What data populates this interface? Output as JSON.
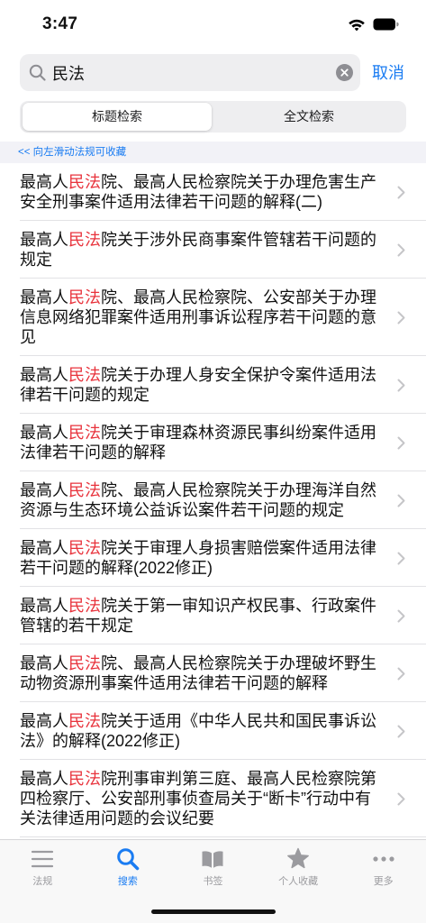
{
  "status_bar": {
    "time": "3:47",
    "wifi_icon": "wifi-icon",
    "battery_icon": "battery-icon"
  },
  "search": {
    "query": "民法",
    "search_icon": "search-icon",
    "clear_icon": "clear-icon",
    "cancel_label": "取消"
  },
  "segmented_control": {
    "options": [
      {
        "label": "标题检索",
        "selected": true
      },
      {
        "label": "全文检索",
        "selected": false
      }
    ]
  },
  "hint": {
    "text": "<< 向左滑动法规可收藏"
  },
  "results": [
    {
      "before": "最高人",
      "match": "民法",
      "after": "院、最高人民检察院关于办理危害生产安全刑事案件适用法律若干问题的解释(二)"
    },
    {
      "before": "最高人",
      "match": "民法",
      "after": "院关于涉外民商事案件管辖若干问题的规定"
    },
    {
      "before": "最高人",
      "match": "民法",
      "after": "院、最高人民检察院、公安部关于办理信息网络犯罪案件适用刑事诉讼程序若干问题的意见"
    },
    {
      "before": "最高人",
      "match": "民法",
      "after": "院关于办理人身安全保护令案件适用法律若干问题的规定"
    },
    {
      "before": "最高人",
      "match": "民法",
      "after": "院关于审理森林资源民事纠纷案件适用法律若干问题的解释"
    },
    {
      "before": "最高人",
      "match": "民法",
      "after": "院、最高人民检察院关于办理海洋自然资源与生态环境公益诉讼案件若干问题的规定"
    },
    {
      "before": "最高人",
      "match": "民法",
      "after": "院关于审理人身损害赔偿案件适用法律若干问题的解释(2022修正)"
    },
    {
      "before": "最高人",
      "match": "民法",
      "after": "院关于第一审知识产权民事、行政案件管辖的若干规定"
    },
    {
      "before": "最高人",
      "match": "民法",
      "after": "院、最高人民检察院关于办理破坏野生动物资源刑事案件适用法律若干问题的解释"
    },
    {
      "before": "最高人",
      "match": "民法",
      "after": "院关于适用《中华人民共和国民事诉讼法》的解释(2022修正)"
    },
    {
      "before": "最高人",
      "match": "民法",
      "after": "院刑事审判第三庭、最高人民检察院第四检察厅、公安部刑事侦查局关于“断卡”行动中有关法律适用问题的会议纪要"
    }
  ],
  "tab_bar": {
    "tabs": [
      {
        "label": "法规",
        "icon": "list-icon",
        "active": false
      },
      {
        "label": "搜索",
        "icon": "search-icon",
        "active": true
      },
      {
        "label": "书签",
        "icon": "book-icon",
        "active": false
      },
      {
        "label": "个人收藏",
        "icon": "star-icon",
        "active": false
      },
      {
        "label": "更多",
        "icon": "more-icon",
        "active": false
      }
    ]
  },
  "colors": {
    "accent": "#1a7cf2",
    "highlight": "#e8333c",
    "text": "#111111",
    "tab_inactive": "#9b9b9f"
  }
}
